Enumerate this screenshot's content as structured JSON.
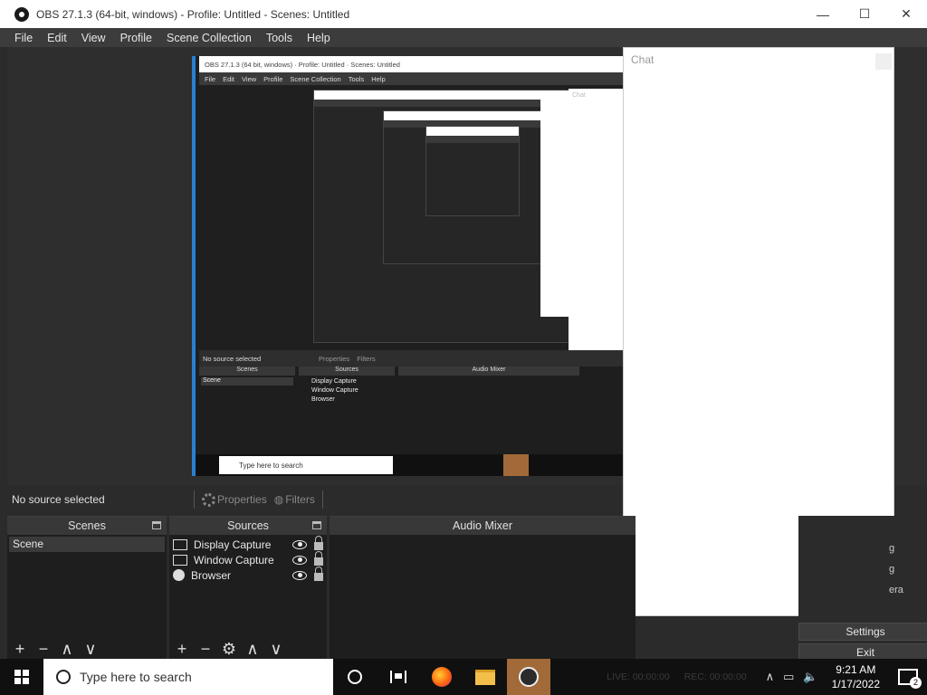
{
  "window": {
    "title": "OBS 27.1.3 (64-bit, windows) - Profile: Untitled - Scenes: Untitled",
    "minimize": "—",
    "maximize": "☐",
    "close": "✕"
  },
  "menu": [
    "File",
    "Edit",
    "View",
    "Profile",
    "Scene Collection",
    "Tools",
    "Help"
  ],
  "preview_nested": {
    "title": "OBS 27.1.3 (64 bit, windows) · Profile: Untitled · Scenes: Untitled",
    "menu": [
      "File",
      "Edit",
      "View",
      "Profile",
      "Scene Collection",
      "Tools",
      "Help"
    ],
    "status": "No source selected",
    "properties": "Properties",
    "filters": "Filters",
    "docks": {
      "scenes": "Scenes",
      "sources": "Sources",
      "mixer": "Audio Mixer"
    },
    "scene": "Scene",
    "sources": [
      "Display Capture",
      "Window Capture",
      "Browser"
    ],
    "search": "Type here to search",
    "chat": "Chat"
  },
  "chat": {
    "title": "Chat"
  },
  "status": {
    "no_source": "No source selected",
    "properties": "Properties",
    "filters": "Filters"
  },
  "scenes": {
    "header": "Scenes",
    "items": [
      "Scene"
    ]
  },
  "sources": {
    "header": "Sources",
    "items": [
      {
        "name": "Display Capture",
        "icon": "monitor-icon"
      },
      {
        "name": "Window Capture",
        "icon": "window-icon"
      },
      {
        "name": "Browser",
        "icon": "globe-icon"
      }
    ]
  },
  "mixer": {
    "header": "Audio Mixer"
  },
  "controls": {
    "partials": [
      "g",
      "g",
      "era"
    ],
    "settings": "Settings",
    "exit": "Exit"
  },
  "taskbar": {
    "search_placeholder": "Type here to search",
    "live": "LIVE: 00:00:00",
    "rec": "REC: 00:00:00",
    "time": "9:21 AM",
    "date": "1/17/2022",
    "notifications": "2"
  }
}
